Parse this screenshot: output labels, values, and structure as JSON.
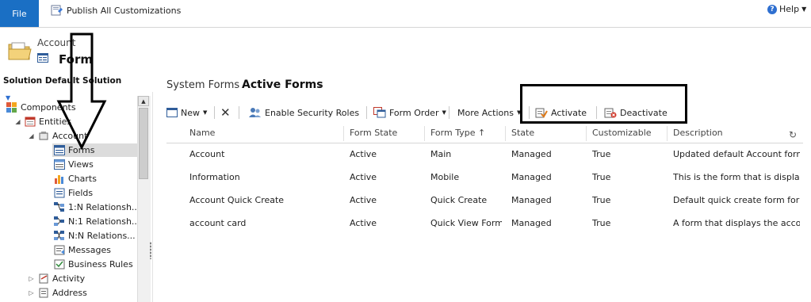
{
  "ribbon": {
    "file_label": "File",
    "publish_label": "Publish All Customizations",
    "help_label": "Help",
    "help_icon": "help-icon"
  },
  "header": {
    "entity_name": "Account",
    "form_name": "Form",
    "solution_label": "Solution Default Solution"
  },
  "nav": {
    "items": [
      {
        "label": "Components"
      },
      {
        "label": "Entities"
      },
      {
        "label": "Account"
      },
      {
        "label": "Forms"
      },
      {
        "label": "Views"
      },
      {
        "label": "Charts"
      },
      {
        "label": "Fields"
      },
      {
        "label": "1:N Relationsh..."
      },
      {
        "label": "N:1 Relationsh..."
      },
      {
        "label": "N:N Relations..."
      },
      {
        "label": "Messages"
      },
      {
        "label": "Business Rules"
      },
      {
        "label": "Activity"
      },
      {
        "label": "Address"
      }
    ]
  },
  "main": {
    "view_label": "System Forms",
    "view_name": "Active Forms"
  },
  "toolbar": {
    "new_label": "New",
    "enable_security_label": "Enable Security Roles",
    "form_order_label": "Form Order",
    "more_actions_label": "More Actions",
    "activate_label": "Activate",
    "deactivate_label": "Deactivate"
  },
  "grid": {
    "columns": [
      "Name",
      "Form State",
      "Form Type ↑",
      "State",
      "Customizable",
      "Description"
    ],
    "rows": [
      [
        "Account",
        "Active",
        "Main",
        "Managed",
        "True",
        "Updated default Account form."
      ],
      [
        "Information",
        "Active",
        "Mobile",
        "Managed",
        "True",
        "This is the form that is displayed"
      ],
      [
        "Account Quick Create",
        "Active",
        "Quick Create",
        "Managed",
        "True",
        "Default quick create form for Ac"
      ],
      [
        "account card",
        "Active",
        "Quick View Form",
        "Managed",
        "True",
        "A form that displays the account"
      ]
    ]
  },
  "colors": {
    "file_tab": "#1a6fc4",
    "selected_nav": "#dcdcdc",
    "annotation": "#000000"
  }
}
